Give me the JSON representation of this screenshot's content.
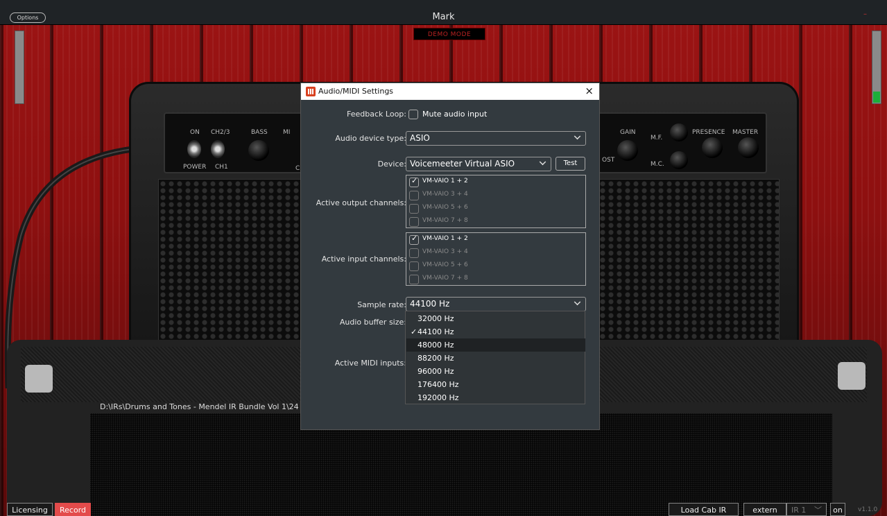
{
  "window": {
    "title": "Mark",
    "options_label": "Options",
    "demo_label": "DEMO MODE"
  },
  "amp": {
    "labels": {
      "on": "ON",
      "ch23": "CH2/3",
      "bass": "BASS",
      "mid_partial": "MI",
      "c_partial": "C",
      "power": "POWER",
      "ch1": "CH1",
      "gain": "GAIN",
      "mf": "M.F.",
      "mc": "M.C.",
      "presence": "PRESENCE",
      "master": "MASTER",
      "boost_partial": "OST"
    }
  },
  "ir_path": "D:\\IRs\\Drums and Tones - Mendel IR Bundle Vol 1\\24",
  "bottom": {
    "licensing": "Licensing",
    "record": "Record",
    "load_cab": "Load Cab IR",
    "extern": "extern",
    "ir_select": "IR 1",
    "on": "on",
    "version": "v1.1.0",
    "record_color": "#e34b4b"
  },
  "dialog": {
    "title": "Audio/MIDI Settings",
    "close": "×",
    "feedback_label": "Feedback Loop:",
    "mute_label": "Mute audio input",
    "device_type_label": "Audio device type:",
    "device_type_value": "ASIO",
    "device_label": "Device:",
    "device_value": "Voicemeeter Virtual ASIO",
    "test_label": "Test",
    "output_label": "Active output channels:",
    "output_channels": [
      {
        "name": "VM-VAIO 1 + 2",
        "checked": true
      },
      {
        "name": "VM-VAIO 3 + 4",
        "checked": false
      },
      {
        "name": "VM-VAIO 5 + 6",
        "checked": false
      },
      {
        "name": "VM-VAIO 7 + 8",
        "checked": false
      }
    ],
    "input_label": "Active input channels:",
    "input_channels": [
      {
        "name": "VM-VAIO 1 + 2",
        "checked": true
      },
      {
        "name": "VM-VAIO 3 + 4",
        "checked": false
      },
      {
        "name": "VM-VAIO 5 + 6",
        "checked": false
      },
      {
        "name": "VM-VAIO 7 + 8",
        "checked": false
      }
    ],
    "sample_rate_label": "Sample rate:",
    "sample_rate_value": "44100 Hz",
    "buffer_label": "Audio buffer size:",
    "midi_label": "Active MIDI inputs:",
    "sample_rate_options": [
      "32000 Hz",
      "44100 Hz",
      "48000 Hz",
      "88200 Hz",
      "96000 Hz",
      "176400 Hz",
      "192000 Hz"
    ],
    "sample_rate_selected": "44100 Hz",
    "sample_rate_hover": "48000 Hz",
    "tick": "✓"
  },
  "meters": {
    "left_level": 0,
    "right_level": 0.15
  }
}
